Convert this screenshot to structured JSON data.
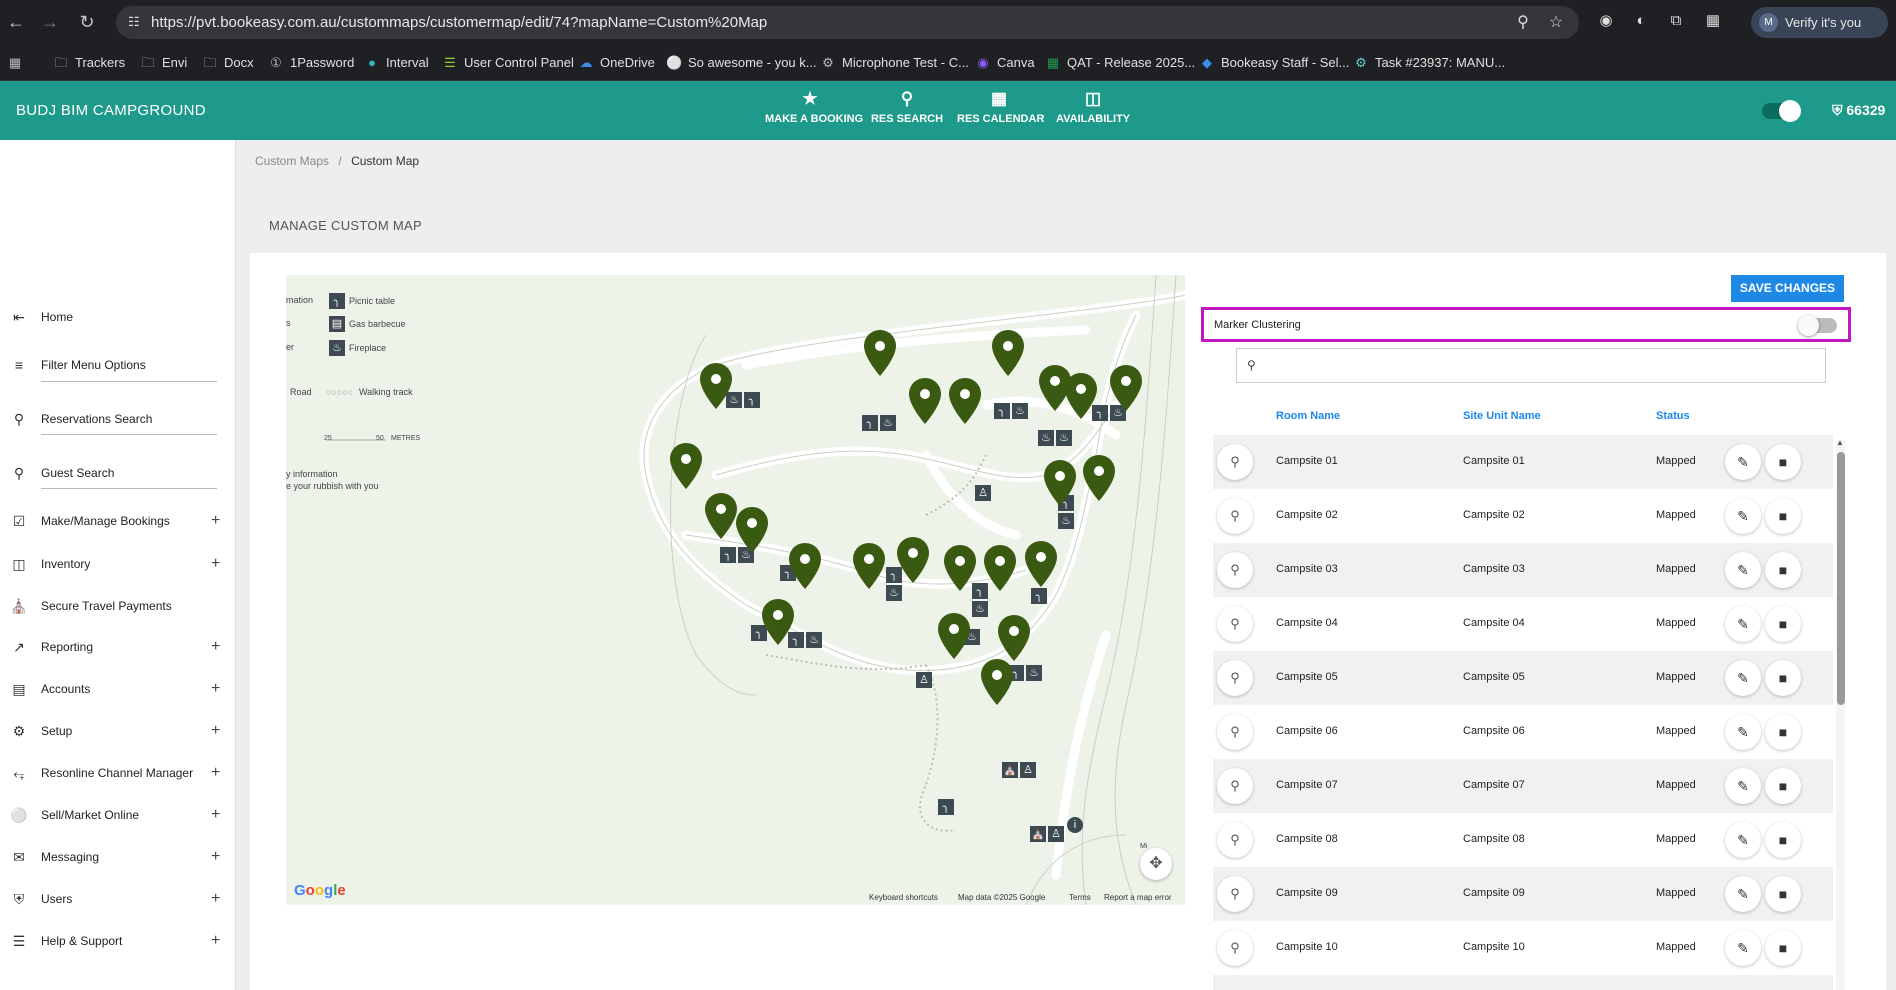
{
  "browser": {
    "url": "https://pvt.bookeasy.com.au/custommaps/customermap/edit/74?mapName=Custom%20Map",
    "verify_label": "Verify it's you",
    "avatar_letter": "M"
  },
  "bookmarks": [
    {
      "label": "Trackers",
      "icon": "folder-icon"
    },
    {
      "label": "Envi",
      "icon": "folder-icon"
    },
    {
      "label": "Docx",
      "icon": "folder-icon"
    },
    {
      "label": "1Password",
      "icon": "1password-icon"
    },
    {
      "label": "Interval",
      "icon": "interval-icon"
    },
    {
      "label": "User Control Panel",
      "icon": "wifi-icon"
    },
    {
      "label": "OneDrive",
      "icon": "onedrive-icon"
    },
    {
      "label": "So awesome - you k...",
      "icon": "globe-icon"
    },
    {
      "label": "Microphone Test - C...",
      "icon": "gear-icon"
    },
    {
      "label": "Canva",
      "icon": "canva-icon"
    },
    {
      "label": "QAT - Release 2025...",
      "icon": "excel-icon"
    },
    {
      "label": "Bookeasy Staff - Sel...",
      "icon": "bookeasy-icon"
    },
    {
      "label": "Task #23937: MANU...",
      "icon": "task-icon"
    }
  ],
  "header": {
    "brand": "BUDJ BIM CAMPGROUND",
    "nav": [
      {
        "label": "MAKE A BOOKING",
        "icon": "star-icon"
      },
      {
        "label": "RES SEARCH",
        "icon": "search-icon"
      },
      {
        "label": "RES CALENDAR",
        "icon": "calendar-icon"
      },
      {
        "label": "AVAILABILITY",
        "icon": "bed-icon"
      }
    ],
    "badge": "66329"
  },
  "sidebar": {
    "items": [
      {
        "label": "Home",
        "icon": "menu-back-icon",
        "expandable": false
      },
      {
        "label": "Filter Menu Options",
        "icon": "filter-icon",
        "expandable": false
      },
      {
        "label": "Reservations Search",
        "icon": "search-icon",
        "expandable": false
      },
      {
        "label": "Guest Search",
        "icon": "search-icon",
        "expandable": false
      },
      {
        "label": "Make/Manage Bookings",
        "icon": "calendar-check-icon",
        "expandable": true
      },
      {
        "label": "Inventory",
        "icon": "bed-icon",
        "expandable": true
      },
      {
        "label": "Secure Travel Payments",
        "icon": "bank-icon",
        "expandable": false
      },
      {
        "label": "Reporting",
        "icon": "trending-icon",
        "expandable": true
      },
      {
        "label": "Accounts",
        "icon": "credit-card-icon",
        "expandable": true
      },
      {
        "label": "Setup",
        "icon": "gear-icon",
        "expandable": true
      },
      {
        "label": "Resonline Channel Manager",
        "icon": "share-icon",
        "expandable": true
      },
      {
        "label": "Sell/Market Online",
        "icon": "globe-icon",
        "expandable": true
      },
      {
        "label": "Messaging",
        "icon": "message-icon",
        "expandable": true
      },
      {
        "label": "Users",
        "icon": "shield-icon",
        "expandable": true
      },
      {
        "label": "Help & Support",
        "icon": "forum-icon",
        "expandable": true
      }
    ]
  },
  "breadcrumb": {
    "parent": "Custom Maps",
    "separator": "/",
    "current": "Custom Map"
  },
  "page_title": "MANAGE CUSTOM MAP",
  "map": {
    "legend": [
      {
        "label": "Picnic table"
      },
      {
        "label": "Gas barbecue"
      },
      {
        "label": "Fireplace"
      }
    ],
    "legend_cut": [
      "mation",
      "s",
      "er"
    ],
    "road_label": "Road",
    "walking_label": "Walking track",
    "scale": {
      "a": "25",
      "b": "50",
      "unit": "METRES"
    },
    "info_lines": [
      "y information",
      "e your rubbish with you"
    ],
    "google": "Google",
    "footer": [
      "Keyboard shortcuts",
      "Map data ©2025 Google",
      "Terms",
      "Report a map error"
    ],
    "corner_label": "Mi"
  },
  "panel": {
    "save_label": "SAVE CHANGES",
    "clustering_label": "Marker Clustering",
    "clustering_on": false,
    "search_placeholder": "",
    "columns": {
      "room": "Room Name",
      "site": "Site Unit Name",
      "status": "Status"
    },
    "rows": [
      {
        "room": "Campsite 01",
        "site": "Campsite 01",
        "status": "Mapped"
      },
      {
        "room": "Campsite 02",
        "site": "Campsite 02",
        "status": "Mapped"
      },
      {
        "room": "Campsite 03",
        "site": "Campsite 03",
        "status": "Mapped"
      },
      {
        "room": "Campsite 04",
        "site": "Campsite 04",
        "status": "Mapped"
      },
      {
        "room": "Campsite 05",
        "site": "Campsite 05",
        "status": "Mapped"
      },
      {
        "room": "Campsite 06",
        "site": "Campsite 06",
        "status": "Mapped"
      },
      {
        "room": "Campsite 07",
        "site": "Campsite 07",
        "status": "Mapped"
      },
      {
        "room": "Campsite 08",
        "site": "Campsite 08",
        "status": "Mapped"
      },
      {
        "room": "Campsite 09",
        "site": "Campsite 09",
        "status": "Mapped"
      },
      {
        "room": "Campsite 10",
        "site": "Campsite 10",
        "status": "Mapped"
      }
    ]
  },
  "colors": {
    "header_teal": "#1e9a8a",
    "save_blue": "#1e88e5",
    "highlight_magenta": "#c217c2",
    "marker_green": "#3a5a12",
    "map_bg": "#eef3ea"
  }
}
